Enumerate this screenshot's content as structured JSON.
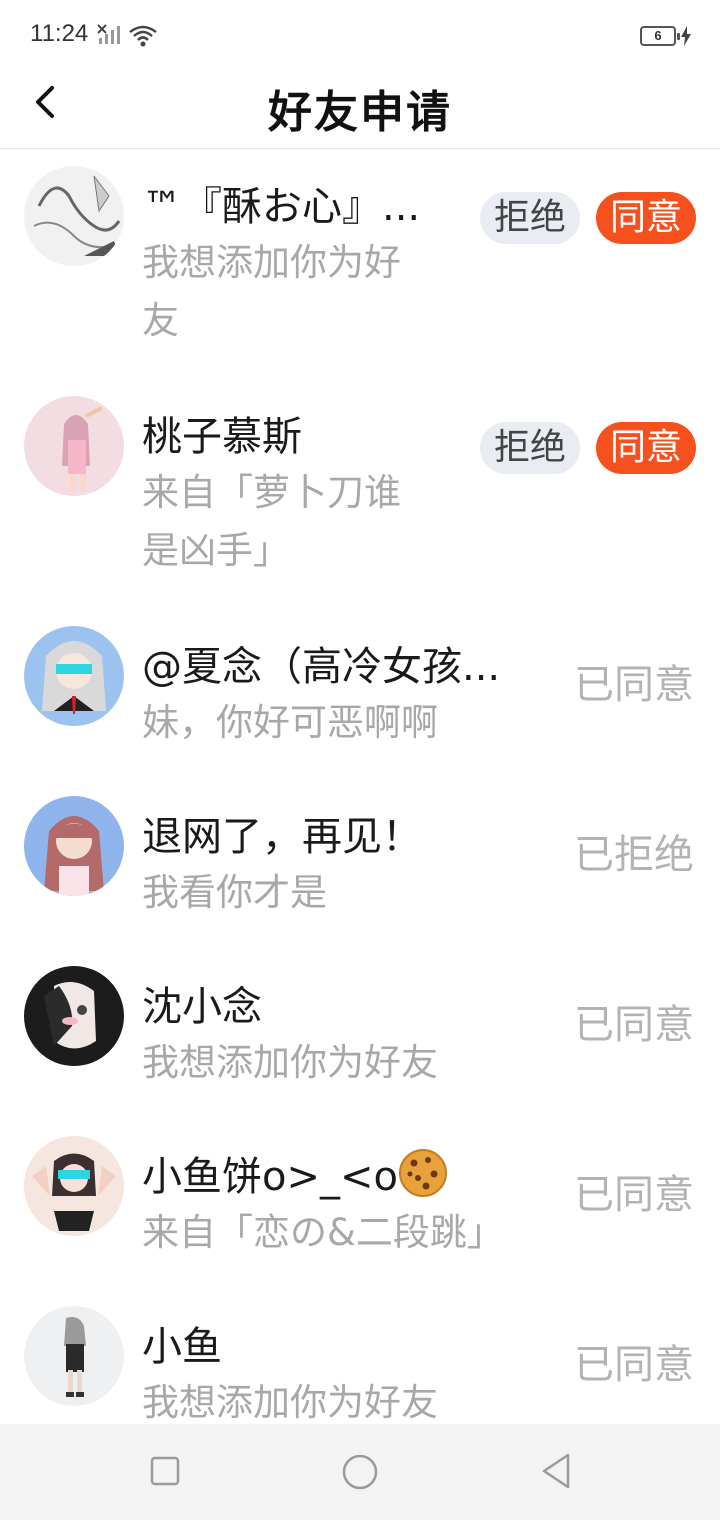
{
  "status_bar": {
    "time": "11:24",
    "battery_level": "6",
    "icons": [
      "no-signal-icon",
      "wifi-icon",
      "battery-icon",
      "charging-bolt-icon"
    ]
  },
  "header": {
    "title": "好友申请",
    "back_icon": "chevron-left-icon"
  },
  "colors": {
    "accept_button": "#f4511e",
    "reject_button_bg": "#e9ecf2",
    "secondary_text": "#a8a8a8",
    "status_text": "#b3b3b3"
  },
  "requests": [
    {
      "name": "™『酥お心』...",
      "message_line1": "我想添加你为好",
      "message_line2": "友",
      "reject_label": "拒绝",
      "accept_label": "同意"
    },
    {
      "name": "桃子慕斯",
      "message_line1": "来自「萝卜刀谁",
      "message_line2": "是凶手」",
      "reject_label": "拒绝",
      "accept_label": "同意"
    },
    {
      "name": "@夏念（高冷女孩...",
      "message": "妹，你好可恶啊啊",
      "status": "已同意"
    },
    {
      "name": "退网了，再见！",
      "message": "我看你才是",
      "status": "已拒绝"
    },
    {
      "name": "沈小念",
      "message": "我想添加你为好友",
      "status": "已同意"
    },
    {
      "name": "小鱼饼o>_<o",
      "name_emoji": "cookie-icon",
      "message": "来自「恋の&二段跳」",
      "status": "已同意"
    },
    {
      "name": "小鱼",
      "message": "我想添加你为好友",
      "status": "已同意"
    }
  ],
  "nav_bar": {
    "icons": [
      "recent-apps-icon",
      "home-icon",
      "back-triangle-icon"
    ]
  }
}
